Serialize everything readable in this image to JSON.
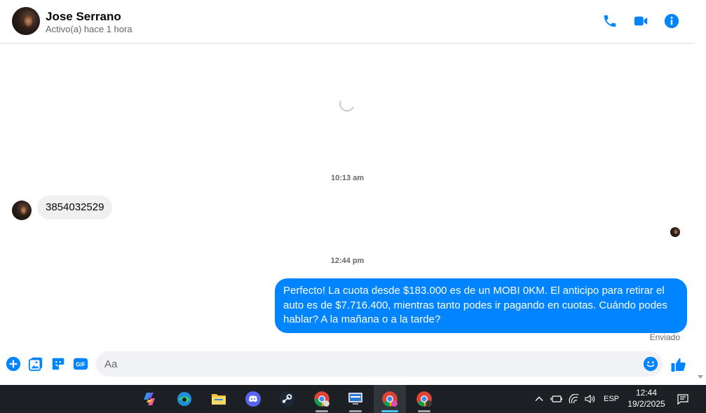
{
  "header": {
    "name": "Jose Serrano",
    "status": "Activo(a) hace 1 hora",
    "icons": [
      "phone-icon",
      "video-icon",
      "info-icon"
    ],
    "accent": "#0084ff"
  },
  "messages": {
    "timestamp_1": "10:13 am",
    "incoming_text": "3854032529",
    "timestamp_2": "12:44 pm",
    "outgoing_text": "Perfecto! La cuota desde $183.000 es de un MOBI 0KM. El anticipo para retirar el auto es de $7.716.400, mientras tanto podes ir pagando en cuotas. Cuándo podes hablar? A la mañana o a la tarde?",
    "sent_label": "Enviado"
  },
  "composer": {
    "placeholder": "Aa",
    "icons": [
      "plus-icon",
      "image-icon",
      "sticker-icon",
      "gif-icon",
      "emoji-icon",
      "like-icon"
    ],
    "gif_label": "GIF"
  },
  "taskbar": {
    "apps": [
      "copilot-icon",
      "edge-icon",
      "file-explorer-icon",
      "discord-icon",
      "steam-icon",
      "chrome-icon",
      "remote-desktop-icon",
      "chrome-icon",
      "chrome-icon"
    ],
    "language": "ESP",
    "time": "12:44",
    "date": "19/2/2025"
  }
}
